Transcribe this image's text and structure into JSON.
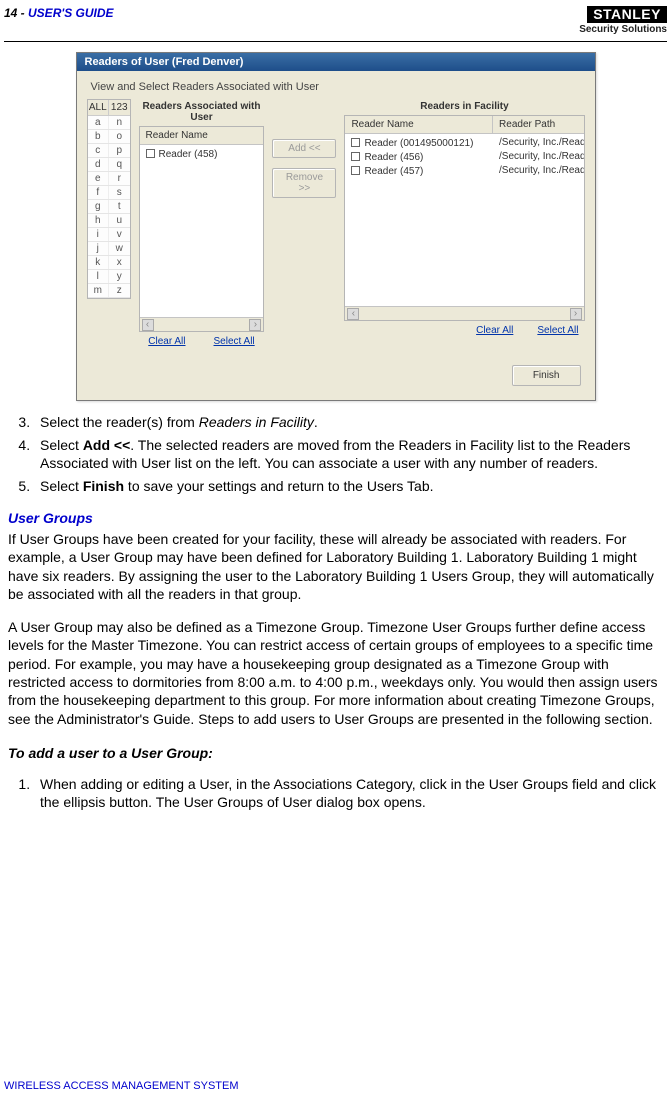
{
  "header": {
    "page_num": "14 - ",
    "title": "USER'S GUIDE"
  },
  "logo": {
    "brand": "STANLEY",
    "sub": "Security Solutions"
  },
  "dialog": {
    "title": "Readers of User (Fred Denver)",
    "subtitle": "View and Select Readers Associated with User",
    "alpha": {
      "head": [
        "ALL",
        "123"
      ],
      "rows": [
        [
          "a",
          "n"
        ],
        [
          "b",
          "o"
        ],
        [
          "c",
          "p"
        ],
        [
          "d",
          "q"
        ],
        [
          "e",
          "r"
        ],
        [
          "f",
          "s"
        ],
        [
          "g",
          "t"
        ],
        [
          "h",
          "u"
        ],
        [
          "i",
          "v"
        ],
        [
          "j",
          "w"
        ],
        [
          "k",
          "x"
        ],
        [
          "l",
          "y"
        ],
        [
          "m",
          "z"
        ]
      ]
    },
    "left_panel": {
      "title": "Readers Associated with User",
      "columns": [
        "Reader Name"
      ],
      "rows": [
        [
          "Reader (458)"
        ]
      ]
    },
    "right_panel": {
      "title": "Readers in Facility",
      "columns": [
        "Reader Name",
        "Reader Path"
      ],
      "rows": [
        [
          "Reader (001495000121)",
          "/Security, Inc./Read.."
        ],
        [
          "Reader (456)",
          "/Security, Inc./Read.."
        ],
        [
          "Reader (457)",
          "/Security, Inc./Read.."
        ]
      ]
    },
    "buttons": {
      "add": "Add   <<",
      "remove": "Remove >>",
      "finish": "Finish"
    },
    "links": {
      "clear": "Clear All",
      "select": "Select All"
    }
  },
  "steps_a": {
    "s3": {
      "pre": "Select the reader(s) from ",
      "em": "Readers in Facility",
      "post": "."
    },
    "s4": {
      "pre": "Select ",
      "b": "Add <<",
      "post": ".   The selected readers are moved from the Readers in Facility list to the Readers Associated with User list on the left.   You can associate a user with any number of readers."
    },
    "s5": {
      "pre": "Select ",
      "b": "Finish",
      "post": " to save your settings and return to the Users Tab."
    }
  },
  "sections": {
    "ug_head": "User Groups",
    "ug_p1": "If User Groups have been created for your facility, these will already be associated with readers.   For example, a User Group may have been defined for Laboratory Building 1.   Laboratory Building 1 might have six readers.   By assigning the user to the Laboratory Building 1 Users Group, they will automatically be associated with all the readers in that group.",
    "ug_p2": "A User Group may also be defined as a Timezone Group.   Timezone User Groups further define access levels for the Master Timezone.   You can restrict access of certain groups of employees to a specific time period.   For example, you may have a housekeeping group designated as a Timezone Group with restricted access to dormitories from 8:00 a.m. to 4:00 p.m., weekdays only.   You would then assign users from the housekeeping department to this group.   For more information about creating Timezone Groups, see the Administrator's Guide.   Steps to add users to User Groups are presented in the following section.",
    "add_head": "To add a user to a User Group:",
    "add_s1": "When adding or editing a User, in the Associations Category, click in the User Groups field and click the ellipsis button.   The User Groups of User dialog box opens."
  },
  "footer": "WIRELESS ACCESS MANAGEMENT SYSTEM"
}
